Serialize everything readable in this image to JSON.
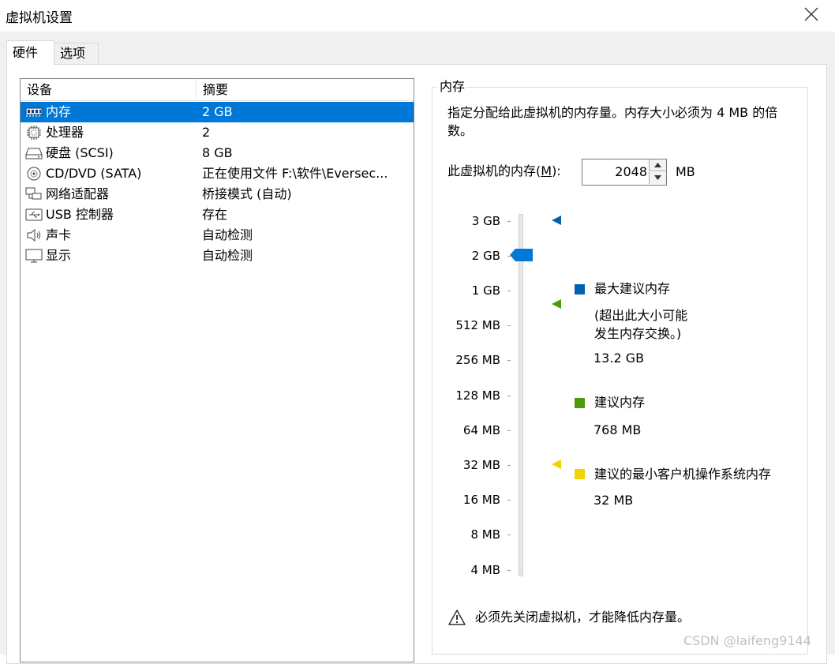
{
  "window": {
    "title": "虚拟机设置"
  },
  "tabs": [
    {
      "label": "硬件"
    },
    {
      "label": "选项"
    }
  ],
  "device_list": {
    "headers": {
      "device": "设备",
      "summary": "摘要"
    },
    "rows": [
      {
        "icon": "memory-icon",
        "name": "内存",
        "summary": "2 GB",
        "selected": true
      },
      {
        "icon": "cpu-icon",
        "name": "处理器",
        "summary": "2"
      },
      {
        "icon": "disk-icon",
        "name": "硬盘 (SCSI)",
        "summary": "8 GB"
      },
      {
        "icon": "cd-icon",
        "name": "CD/DVD (SATA)",
        "summary": "正在使用文件 F:\\软件\\Eversec..."
      },
      {
        "icon": "network-icon",
        "name": "网络适配器",
        "summary": "桥接模式 (自动)"
      },
      {
        "icon": "usb-icon",
        "name": "USB 控制器",
        "summary": "存在"
      },
      {
        "icon": "sound-icon",
        "name": "声卡",
        "summary": "自动检测"
      },
      {
        "icon": "display-icon",
        "name": "显示",
        "summary": "自动检测"
      }
    ]
  },
  "memory": {
    "group_title": "内存",
    "description": "指定分配给此虚拟机的内存量。内存大小必须为 4 MB 的倍数。",
    "label_pre": "此虚拟机的内存(",
    "label_key": "M",
    "label_post": "):",
    "value": "2048",
    "unit": "MB",
    "scale": [
      "3 GB",
      "2 GB",
      "1 GB",
      "512 MB",
      "256 MB",
      "128 MB",
      "64 MB",
      "32 MB",
      "16 MB",
      "8 MB",
      "4 MB"
    ],
    "legend": {
      "max": {
        "title": "最大建议内存",
        "note1": "(超出此大小可能",
        "note2": "发生内存交换。)",
        "value": "13.2 GB",
        "color": "#0063b1"
      },
      "recommended": {
        "title": "建议内存",
        "value": "768 MB",
        "color": "#4a9a0a"
      },
      "minimum": {
        "title": "建议的最小客户机操作系统内存",
        "value": "32 MB",
        "color": "#f2d400"
      }
    },
    "thumb_color": "#0078d7",
    "warning": "必须先关闭虚拟机，才能降低内存量。"
  },
  "watermark": "CSDN @laifeng9144"
}
